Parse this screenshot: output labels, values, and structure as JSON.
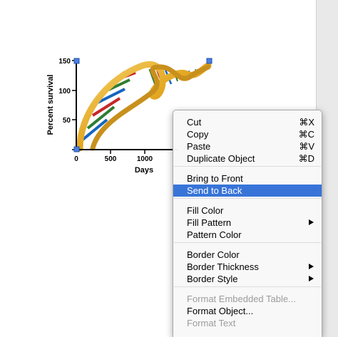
{
  "graph": {
    "y_axis_title": "Percent survival",
    "x_axis_title": "Days",
    "y_ticks": [
      "0",
      "50",
      "100",
      "150"
    ],
    "x_ticks": [
      "0",
      "500",
      "1000"
    ],
    "embedded_image": "dna-double-helix"
  },
  "context_menu": {
    "items": [
      {
        "label": "Cut",
        "shortcut": "⌘X"
      },
      {
        "label": "Copy",
        "shortcut": "⌘C"
      },
      {
        "label": "Paste",
        "shortcut": "⌘V"
      },
      {
        "label": "Duplicate Object",
        "shortcut": "⌘D"
      },
      {
        "label": "Bring to Front"
      },
      {
        "label": "Send to Back",
        "selected": true
      },
      {
        "label": "Fill Color"
      },
      {
        "label": "Fill Pattern",
        "submenu": true
      },
      {
        "label": "Pattern Color"
      },
      {
        "label": "Border Color"
      },
      {
        "label": "Border Thickness",
        "submenu": true
      },
      {
        "label": "Border Style",
        "submenu": true
      },
      {
        "label": "Format Embedded Table...",
        "disabled": true
      },
      {
        "label": "Format Object..."
      },
      {
        "label": "Format Text",
        "disabled": true
      }
    ]
  },
  "colors": {
    "selection": "#3874d8",
    "handle": "#4a7fe0",
    "helix_gold": "#e8b02c"
  }
}
